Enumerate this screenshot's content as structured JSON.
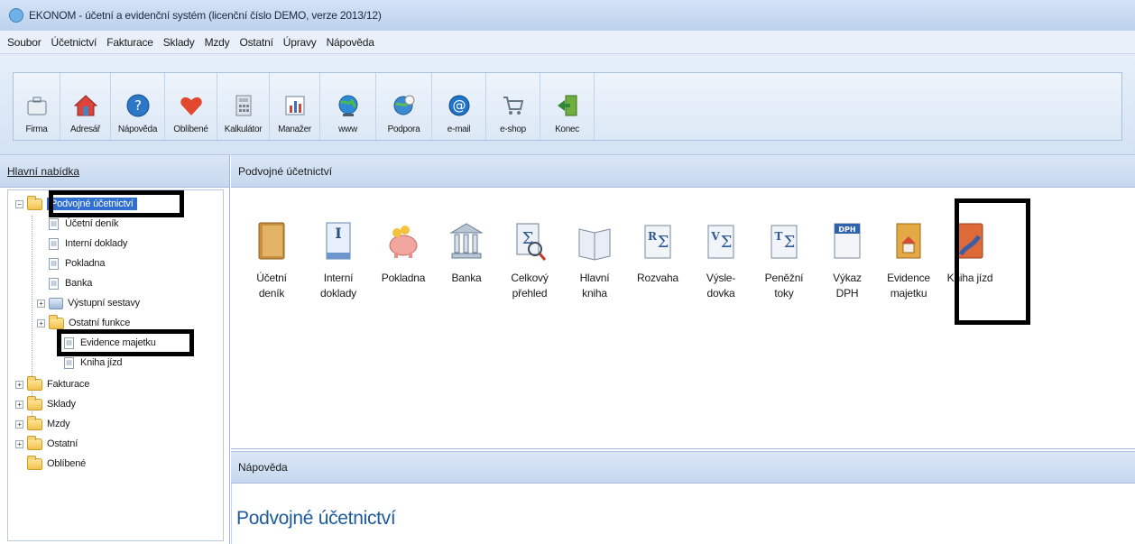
{
  "window": {
    "title": "EKONOM - účetní a evidenční systém (licenční číslo DEMO, verze 2013/12)"
  },
  "menu": [
    "Soubor",
    "Účetnictví",
    "Fakturace",
    "Sklady",
    "Mzdy",
    "Ostatní",
    "Úpravy",
    "Nápověda"
  ],
  "toolbar": [
    {
      "label": "Firma",
      "icon": "briefcase-icon"
    },
    {
      "label": "Adresář",
      "icon": "house-icon"
    },
    {
      "label": "Nápověda",
      "icon": "help-icon"
    },
    {
      "label": "Oblíbené",
      "icon": "heart-icon"
    },
    {
      "label": "Kalkulátor",
      "icon": "calculator-icon"
    },
    {
      "label": "Manažer",
      "icon": "chart-icon"
    },
    {
      "label": "www",
      "icon": "globe-icon"
    },
    {
      "label": "Podpora",
      "icon": "support-globe-icon"
    },
    {
      "label": "e-mail",
      "icon": "at-icon"
    },
    {
      "label": "e-shop",
      "icon": "cart-icon"
    },
    {
      "label": "Konec",
      "icon": "exit-door-icon"
    }
  ],
  "left_panel": {
    "header": "Hlavní nabídka",
    "tree": [
      {
        "label": "Podvojné účetnictví",
        "type": "folder",
        "level": 0,
        "expander": "−",
        "selected": true
      },
      {
        "label": "Účetní deník",
        "type": "doc",
        "level": 1
      },
      {
        "label": "Interní doklady",
        "type": "doc",
        "level": 1
      },
      {
        "label": "Pokladna",
        "type": "doc",
        "level": 1
      },
      {
        "label": "Banka",
        "type": "doc",
        "level": 1
      },
      {
        "label": "Výstupní sestavy",
        "type": "reports",
        "level": 1,
        "expander": "+"
      },
      {
        "label": "Ostatní funkce",
        "type": "folder",
        "level": 1,
        "expander": "+"
      },
      {
        "label": "Evidence majetku",
        "type": "doc",
        "level": 1
      },
      {
        "label": "Kniha jízd",
        "type": "doc",
        "level": 1
      },
      {
        "label": "Fakturace",
        "type": "folder",
        "level": 0,
        "expander": "+"
      },
      {
        "label": "Sklady",
        "type": "folder",
        "level": 0,
        "expander": "+"
      },
      {
        "label": "Mzdy",
        "type": "folder",
        "level": 0,
        "expander": "+"
      },
      {
        "label": "Ostatní",
        "type": "folder",
        "level": 0,
        "expander": "+"
      },
      {
        "label": "Oblíbené",
        "type": "folder",
        "level": 0
      }
    ]
  },
  "main_panel": {
    "header": "Podvojné účetnictví",
    "icons": [
      {
        "line1": "Účetní",
        "line2": "deník",
        "icon": "journal-book-icon"
      },
      {
        "line1": "Interní",
        "line2": "doklady",
        "icon": "internal-document-icon"
      },
      {
        "line1": "Pokladna",
        "line2": "",
        "icon": "piggy-bank-icon"
      },
      {
        "line1": "Banka",
        "line2": "",
        "icon": "bank-icon"
      },
      {
        "line1": "Celkový",
        "line2": "přehled",
        "icon": "overview-icon"
      },
      {
        "line1": "Hlavní",
        "line2": "kniha",
        "icon": "ledger-icon"
      },
      {
        "line1": "Rozvaha",
        "line2": "",
        "icon": "balance-sheet-icon"
      },
      {
        "line1": "Výsle-",
        "line2": "dovka",
        "icon": "income-statement-icon"
      },
      {
        "line1": "Peněžní",
        "line2": "toky",
        "icon": "cash-flow-icon"
      },
      {
        "line1": "Výkaz",
        "line2": "DPH",
        "icon": "vat-report-icon"
      },
      {
        "line1": "Evidence",
        "line2": "majetku",
        "icon": "asset-register-icon"
      },
      {
        "line1": "Kniha jízd",
        "line2": "",
        "icon": "logbook-icon"
      }
    ]
  },
  "help_panel": {
    "header": "Nápověda",
    "title": "Podvojné účetnictví"
  },
  "colors": {
    "selection": "#2f6fd0",
    "help_title": "#1e5a9c",
    "highlight_box": "#000000"
  }
}
